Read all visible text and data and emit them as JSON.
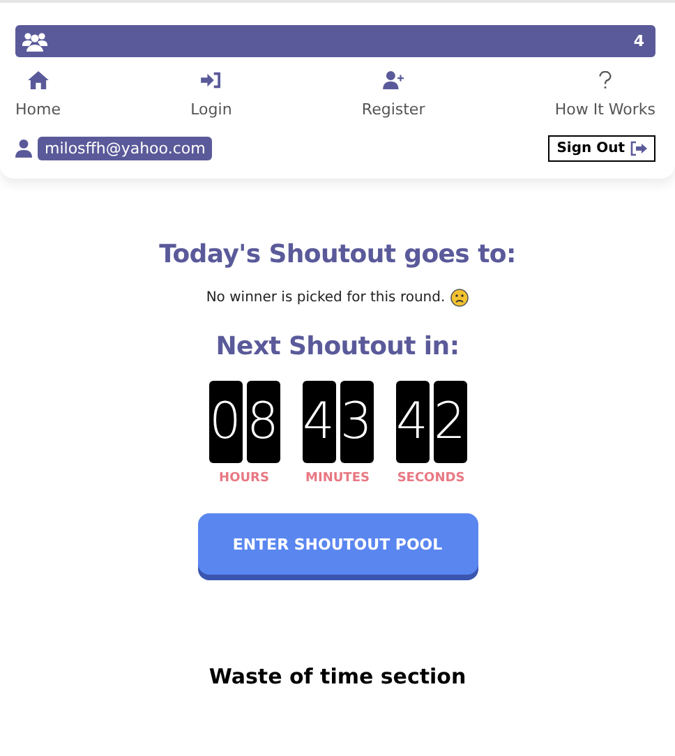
{
  "header": {
    "online_count": "4",
    "nav": [
      {
        "label": "Home"
      },
      {
        "label": "Login"
      },
      {
        "label": "Register"
      },
      {
        "label": "How It Works"
      }
    ],
    "user_email": "milosffh@yahoo.com",
    "sign_out": "Sign Out"
  },
  "winner_title": "Today's Shoutout goes to:",
  "winner_text": "No winner is picked for this round.",
  "next_title": "Next Shoutout in:",
  "countdown": [
    {
      "digits": [
        "0",
        "8"
      ],
      "label": "HOURS"
    },
    {
      "digits": [
        "4",
        "3"
      ],
      "label": "MINUTES"
    },
    {
      "digits": [
        "4",
        "2"
      ],
      "label": "SECONDS"
    }
  ],
  "enter_button": "ENTER SHOUTOUT POOL",
  "section_title": "Waste of time section"
}
